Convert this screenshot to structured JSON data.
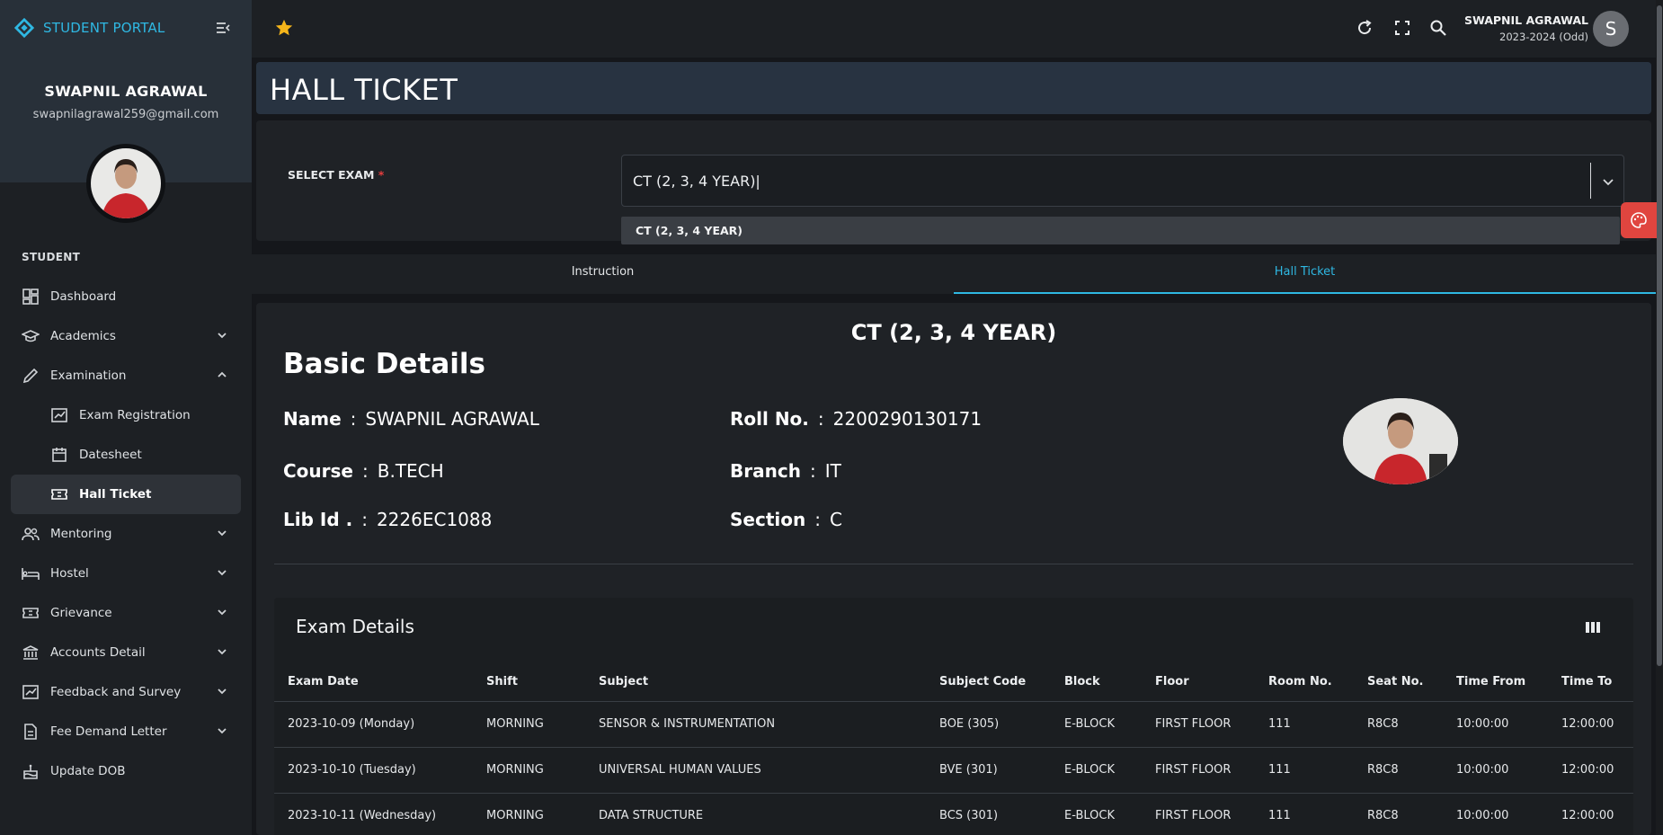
{
  "app": {
    "brand": "STUDENT PORTAL",
    "accent": "#2fb8e3"
  },
  "sidebar": {
    "user_name": "SWAPNIL AGRAWAL",
    "user_email": "swapnilagrawal259@gmail.com",
    "section_label": "STUDENT",
    "items": [
      {
        "label": "Dashboard",
        "icon": "dashboard-icon"
      },
      {
        "label": "Academics",
        "icon": "graduation-cap-icon"
      },
      {
        "label": "Examination",
        "icon": "pencil-icon"
      },
      {
        "label": "Exam Registration",
        "icon": "chart-icon"
      },
      {
        "label": "Datesheet",
        "icon": "calendar-icon"
      },
      {
        "label": "Hall Ticket",
        "icon": "ticket-icon"
      },
      {
        "label": "Mentoring",
        "icon": "people-icon"
      },
      {
        "label": "Hostel",
        "icon": "bed-icon"
      },
      {
        "label": "Grievance",
        "icon": "ticket-icon"
      },
      {
        "label": "Accounts Detail",
        "icon": "bank-icon"
      },
      {
        "label": "Feedback and Survey",
        "icon": "feedback-icon"
      },
      {
        "label": "Fee Demand Letter",
        "icon": "document-icon"
      },
      {
        "label": "Update DOB",
        "icon": "cake-icon"
      }
    ]
  },
  "topbar": {
    "user_name": "SWAPNIL AGRAWAL",
    "term": "2023-2024 (Odd)",
    "avatar_letter": "S"
  },
  "page": {
    "title": "HALL TICKET"
  },
  "exam_select": {
    "label": "SELECT EXAM",
    "required_mark": "*",
    "value": "CT (2, 3, 4 YEAR)|",
    "option": "CT (2, 3, 4 YEAR)"
  },
  "tabs": [
    {
      "label": "Instruction",
      "active": false
    },
    {
      "label": "Hall Ticket",
      "active": true
    }
  ],
  "ticket": {
    "exam_heading": "CT (2, 3, 4 YEAR)",
    "basic_title": "Basic Details",
    "fields": {
      "name": {
        "key": "Name",
        "value": "SWAPNIL AGRAWAL"
      },
      "roll": {
        "key": "Roll No.",
        "value": "2200290130171"
      },
      "course": {
        "key": "Course",
        "value": "B.TECH"
      },
      "branch": {
        "key": "Branch",
        "value": "IT"
      },
      "lib": {
        "key": "Lib Id .",
        "value": "2226EC1088"
      },
      "section": {
        "key": "Section",
        "value": "C"
      }
    },
    "separator": ":"
  },
  "exam_details": {
    "title": "Exam Details",
    "columns": [
      "Exam Date",
      "Shift",
      "Subject",
      "Subject Code",
      "Block",
      "Floor",
      "Room No.",
      "Seat No.",
      "Time From",
      "Time To"
    ],
    "rows": [
      [
        "2023-10-09 (Monday)",
        "MORNING",
        "SENSOR & INSTRUMENTATION",
        "BOE (305)",
        "E-BLOCK",
        "FIRST FLOOR",
        "111",
        "R8C8",
        "10:00:00",
        "12:00:00"
      ],
      [
        "2023-10-10 (Tuesday)",
        "MORNING",
        "UNIVERSAL HUMAN VALUES",
        "BVE (301)",
        "E-BLOCK",
        "FIRST FLOOR",
        "111",
        "R8C8",
        "10:00:00",
        "12:00:00"
      ],
      [
        "2023-10-11 (Wednesday)",
        "MORNING",
        "DATA STRUCTURE",
        "BCS (301)",
        "E-BLOCK",
        "FIRST FLOOR",
        "111",
        "R8C8",
        "10:00:00",
        "12:00:00"
      ]
    ]
  }
}
